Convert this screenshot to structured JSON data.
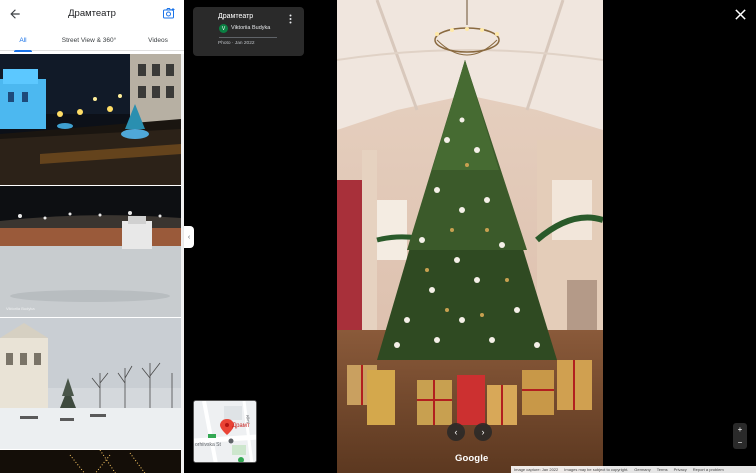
{
  "panel": {
    "title": "Драмтеатр",
    "tabs": [
      {
        "label": "All",
        "active": true
      },
      {
        "label": "Street View & 360°",
        "active": false
      },
      {
        "label": "Videos",
        "active": false
      }
    ],
    "photo_attribution": "Viktoriia Budyka"
  },
  "info_card": {
    "title": "Драмтеатр",
    "author_initial": "V",
    "author": "Viktoriia Budyka",
    "date": "Photo · Jan 2022"
  },
  "map": {
    "street_label": "orhiivska St",
    "place_label": "Драмт",
    "side_label": "Alley"
  },
  "branding": {
    "logo": "Google"
  },
  "zoom": {
    "plus": "+",
    "minus": "−"
  },
  "footer": {
    "capture": "Image capture: Jan 2022",
    "copyright": "Images may be subject to copyright.",
    "country": "Germany",
    "terms": "Terms",
    "privacy": "Privacy",
    "report": "Report a problem"
  },
  "colors": {
    "accent": "#1a73e8",
    "card_bg": "#2a2a2a",
    "avatar": "#0b8043"
  }
}
